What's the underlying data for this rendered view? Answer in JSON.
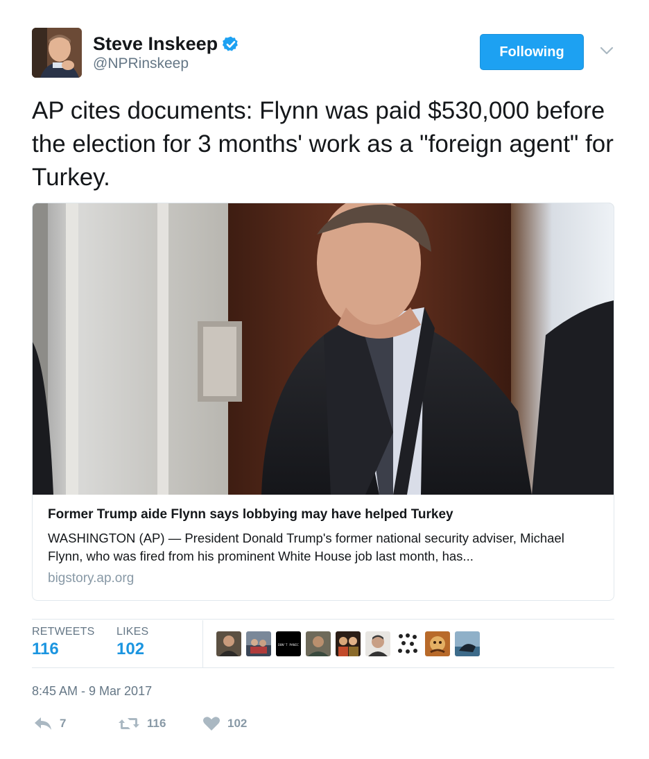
{
  "author": {
    "name": "Steve Inskeep",
    "handle": "@NPRinskeep",
    "verified": true
  },
  "follow_button": {
    "label": "Following",
    "color": "#1da1f2"
  },
  "tweet": {
    "text": "AP cites documents: Flynn was paid $530,000 before the election for 3 months' work as a \"foreign agent\" for Turkey."
  },
  "card": {
    "title": "Former Trump aide Flynn says lobbying may have helped Turkey",
    "description": "WASHINGTON (AP) — President Donald Trump's former national security adviser, Michael Flynn, who was fired from his prominent White House job last month, has...",
    "domain": "bigstory.ap.org"
  },
  "stats": {
    "retweets_label": "RETWEETS",
    "retweets_value": "116",
    "likes_label": "LIKES",
    "likes_value": "102"
  },
  "liker_avatars": [
    {
      "icon": "user-avatar",
      "badge": ""
    },
    {
      "icon": "user-avatar",
      "badge": ""
    },
    {
      "icon": "user-avatar",
      "badge": "DON'T PANIC"
    },
    {
      "icon": "user-avatar",
      "badge": ""
    },
    {
      "icon": "user-avatar",
      "badge": ""
    },
    {
      "icon": "user-avatar",
      "badge": ""
    },
    {
      "icon": "user-avatar",
      "badge": ""
    },
    {
      "icon": "user-avatar",
      "badge": ""
    },
    {
      "icon": "user-avatar",
      "badge": ""
    }
  ],
  "timestamp": "8:45 AM - 9 Mar 2017",
  "actions": {
    "reply_count": "7",
    "retweet_count": "116",
    "like_count": "102"
  },
  "colors": {
    "accent": "#1da1f2",
    "link_blue": "#1b95e0",
    "muted": "#657786",
    "action_gray": "#8899a6"
  }
}
